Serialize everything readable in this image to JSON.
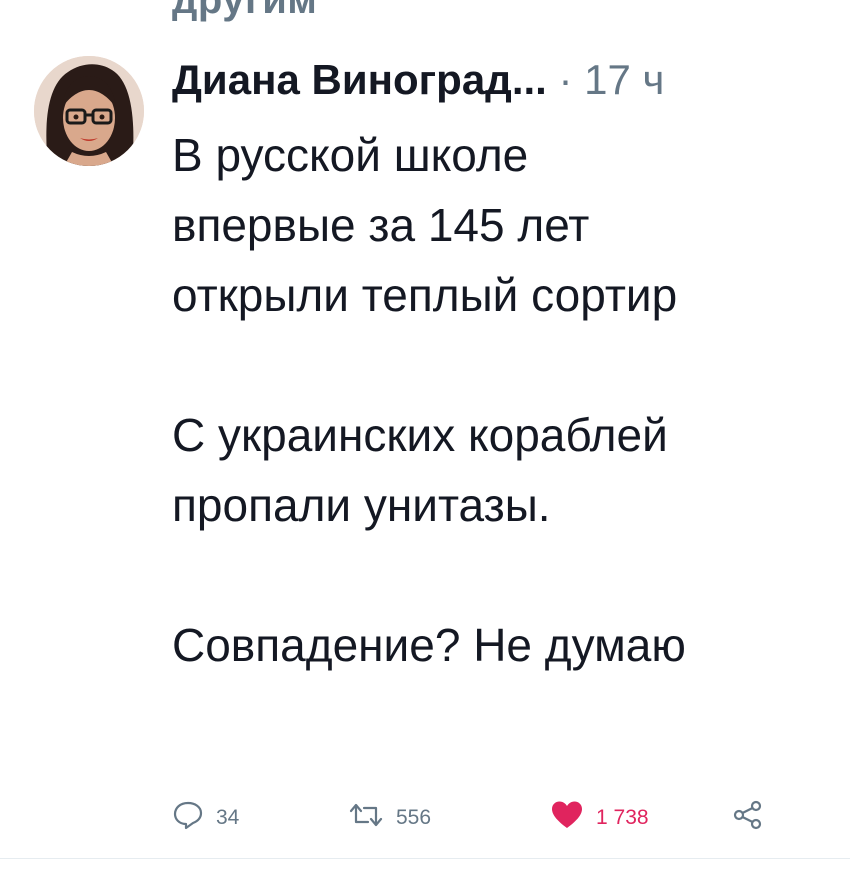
{
  "context": {
    "text": "другим"
  },
  "tweet": {
    "author_name": "Диана Виноград...",
    "separator": " · ",
    "time": "17 ч",
    "lines": [
      "В русской школе",
      "впервые за 145 лет",
      "открыли теплый сортир",
      "",
      "С украинских кораблей",
      "пропали унитазы.",
      "",
      "Совпадение? Не думаю"
    ]
  },
  "actions": {
    "reply_count": "34",
    "retweet_count": "556",
    "like_count": "1 738"
  },
  "colors": {
    "text": "#141823",
    "muted": "#657786",
    "like": "#e0245e"
  },
  "icons": {
    "reply": "speech-bubble-icon",
    "retweet": "retweet-arrows-icon",
    "like": "heart-icon",
    "share": "share-icon"
  }
}
